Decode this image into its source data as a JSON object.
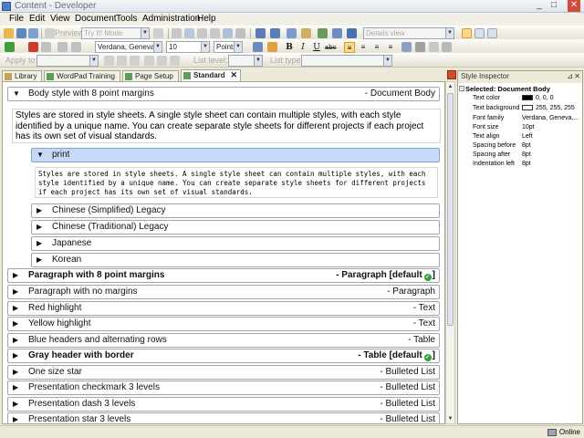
{
  "window": {
    "title": "Content - Developer",
    "controls": [
      "_",
      "□",
      "✕"
    ]
  },
  "menu": [
    "File",
    "Edit",
    "View",
    "Document",
    "Tools",
    "Administration",
    "Help"
  ],
  "toolbar1": {
    "preview_label": "Preview",
    "mode_combo": "Try It! Mode",
    "view_combo": "Details view"
  },
  "toolbar2": {
    "font_combo": "Verdana, Geneva,...",
    "size_combo": "10",
    "unit_combo": "Points",
    "bold": "B",
    "italic": "I",
    "underline": "U",
    "strike": "abc"
  },
  "toolbar3": {
    "apply_to_label": "Apply to:",
    "list_level_label": "List level:",
    "list_type_label": "List type:"
  },
  "tabs": [
    {
      "label": "Library",
      "active": false
    },
    {
      "label": "WordPad Training",
      "active": false
    },
    {
      "label": "Page Setup",
      "active": false
    },
    {
      "label": "Standard",
      "active": true
    }
  ],
  "styles": {
    "body_style": {
      "name": "Body style with 8 point margins",
      "kind": "- Document Body"
    },
    "body_preview": "Styles are stored in style sheets. A single style sheet can contain multiple styles, with each style identified by a unique name. You can create separate style sheets for different projects if each project has its own set of visual standards.",
    "print": {
      "name": "print"
    },
    "print_preview": "Styles are stored in style sheets. A single style sheet can contain multiple styles, with each style identified by a unique name. You can create separate style sheets for different projects if each project has its own set of visual standards.",
    "languages": [
      {
        "name": "Chinese (Simplified) Legacy"
      },
      {
        "name": "Chinese (Traditional) Legacy"
      },
      {
        "name": "Japanese"
      },
      {
        "name": "Korean"
      }
    ],
    "list": [
      {
        "name": "Paragraph with 8 point margins",
        "kind": "- Paragraph [default",
        "bold": true,
        "default": true
      },
      {
        "name": "Paragraph with no margins",
        "kind": "- Paragraph",
        "bold": false,
        "default": false
      },
      {
        "name": "Red highlight",
        "kind": "- Text",
        "bold": false,
        "default": false
      },
      {
        "name": "Yellow highlight",
        "kind": "- Text",
        "bold": false,
        "default": false
      },
      {
        "name": "Blue headers and alternating rows",
        "kind": "- Table",
        "bold": false,
        "default": false
      },
      {
        "name": "Gray header with border",
        "kind": "- Table [default",
        "bold": true,
        "default": true
      },
      {
        "name": "One size star",
        "kind": "- Bulleted List",
        "bold": false,
        "default": false
      },
      {
        "name": "Presentation checkmark 3 levels",
        "kind": "- Bulleted List",
        "bold": false,
        "default": false
      },
      {
        "name": "Presentation dash 3 levels",
        "kind": "- Bulleted List",
        "bold": false,
        "default": false
      },
      {
        "name": "Presentation star 3 levels",
        "kind": "- Bulleted List",
        "bold": false,
        "default": false
      }
    ],
    "default_suffix": "]"
  },
  "inspector": {
    "title": "Style Inspector",
    "selected": "Selected: Document Body",
    "props": [
      {
        "label": "Text color",
        "value": "0, 0, 0",
        "swatch": "#000000"
      },
      {
        "label": "Text background",
        "value": "255, 255, 255",
        "swatch": "#ffffff"
      },
      {
        "label": "Font family",
        "value": "Verdana, Geneva,..."
      },
      {
        "label": "Font size",
        "value": "10pt"
      },
      {
        "label": "Text align",
        "value": "Left"
      },
      {
        "label": "Spacing before",
        "value": "8pt"
      },
      {
        "label": "Spacing after",
        "value": "8pt"
      },
      {
        "label": "Indentation left",
        "value": "8pt"
      }
    ]
  },
  "status": {
    "online": "Online"
  },
  "colors": {
    "accent": "#fbd78a",
    "selection": "#c6daf5",
    "default_badge": "#2ea33a"
  }
}
